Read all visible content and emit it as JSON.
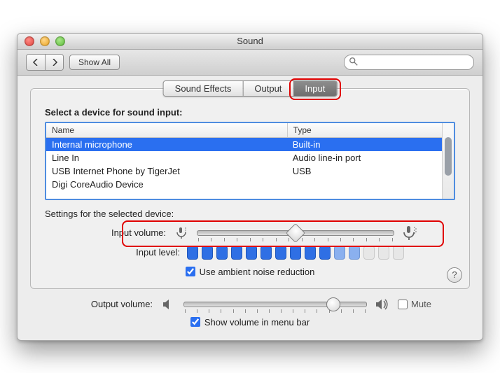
{
  "title": "Sound",
  "toolbar": {
    "show_all": "Show All",
    "search_placeholder": ""
  },
  "tabs": [
    "Sound Effects",
    "Output",
    "Input"
  ],
  "active_tab": 2,
  "select_label": "Select a device for sound input:",
  "columns": {
    "name": "Name",
    "type": "Type"
  },
  "devices": [
    {
      "name": "Internal microphone",
      "type": "Built-in",
      "selected": true
    },
    {
      "name": "Line In",
      "type": "Audio line-in port",
      "selected": false
    },
    {
      "name": "USB Internet Phone by TigerJet",
      "type": "USB",
      "selected": false
    },
    {
      "name": "Digi CoreAudio Device",
      "type": "",
      "selected": false
    }
  ],
  "settings_label": "Settings for the selected device:",
  "input_volume_label": "Input volume:",
  "input_volume": 0.5,
  "input_level_label": "Input level:",
  "input_level_count": 15,
  "input_level_on": 10,
  "ambient": {
    "label": "Use ambient noise reduction",
    "checked": true
  },
  "output_volume_label": "Output volume:",
  "output_volume": 0.82,
  "mute": {
    "label": "Mute",
    "checked": false
  },
  "menu_bar": {
    "label": "Show volume in menu bar",
    "checked": true
  },
  "highlight_tab": true,
  "highlight_input_slider": true
}
